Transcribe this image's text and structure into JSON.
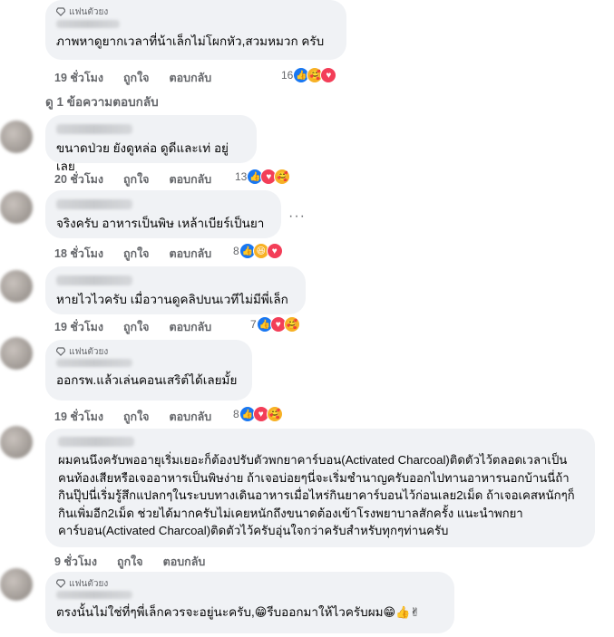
{
  "fan_badge": "แฟนตัวยง",
  "actions": {
    "like": "ถูกใจ",
    "reply": "ตอบกลับ"
  },
  "view_replies": "ดู 1 ข้อความตอบกลับ",
  "comments": [
    {
      "time": "19 ชั่วโมง",
      "count": "16",
      "text": "ภาพหาดูยากเวลาที่น้าเล็กไม่โผกหัว,สวมหมวก ครับ",
      "reactions": [
        "like",
        "care",
        "love"
      ]
    },
    {
      "time": "20 ชั่วโมง",
      "count": "13",
      "text": "ขนาดป่วย ยังดูหล่อ ดูดีและเท่ อยู่เลย",
      "reactions": [
        "like",
        "love",
        "care"
      ]
    },
    {
      "time": "18 ชั่วโมง",
      "count": "8",
      "text": "จริงครับ อาหารเป็นพิษ เหล้าเบียร์เป็นยา",
      "reactions": [
        "like",
        "haha",
        "love"
      ]
    },
    {
      "time": "19 ชั่วโมง",
      "count": "7",
      "text": "หายไวไวครับ เมื่อวานดูคลิปบนเวทีไม่มีพี่เล็ก",
      "reactions": [
        "like",
        "love",
        "care"
      ]
    },
    {
      "time": "19 ชั่วโมง",
      "count": "8",
      "text": "ออกรพ.แล้วเล่นคอนเสริต์ได้เลยมั้ย",
      "reactions": [
        "like",
        "love",
        "care"
      ]
    },
    {
      "time": "9 ชั่วโมง",
      "count": "",
      "text": "ผมคนนึงครับพออายุเริ่มเยอะก็ต้องปรับตัวพกยาคาร์บอน(Activated Charcoal)ติดตัวไว้ตลอดเวลาเป็นคนท้องเสียหรือเจออาหารเป็นพิษง่าย ถ้าเจอบ่อยๆนี่จะเริ่มชำนาญครับออกไปทานอาหารนอกบ้านนี่ถ้ากินปุ๊ปนี่เริ่มรู้สึกแปลกๆในระบบทางเดินอาหารเมื่อไหร่กินยาคาร์บอนไว้ก่อนเลย2เม็ด ถ้าเจอเคสหนักๆก็กินเพิ่มอีก2เม็ด ช่วยได้มากครับไม่เคยหนักถึงขนาดต้องเข้าโรงพยาบาลสักครั้ง แนะนำพกยาคาร์บอน(Activated Charcoal)ติดตัวไว้ครับอุ่นใจกว่าครับสำหรับทุกๆท่านครับ",
      "reactions": []
    },
    {
      "time": "",
      "count": "",
      "text": "ตรงนั้นไม่ใช่ที่ๆพี่เล็กควรจะอยู่นะครับ,",
      "text2": "รีบออกมาให้ไวครับผม",
      "reactions": []
    }
  ],
  "icons": {
    "like": "thumbs-up",
    "love": "heart",
    "care": "care-face",
    "haha": "laughing-face",
    "fan": "diamond-icon"
  },
  "colors": {
    "bubble": "#f0f2f5",
    "meta": "#65676b",
    "like": "#1877f2",
    "love": "#f33e58",
    "care": "#f7b125"
  }
}
